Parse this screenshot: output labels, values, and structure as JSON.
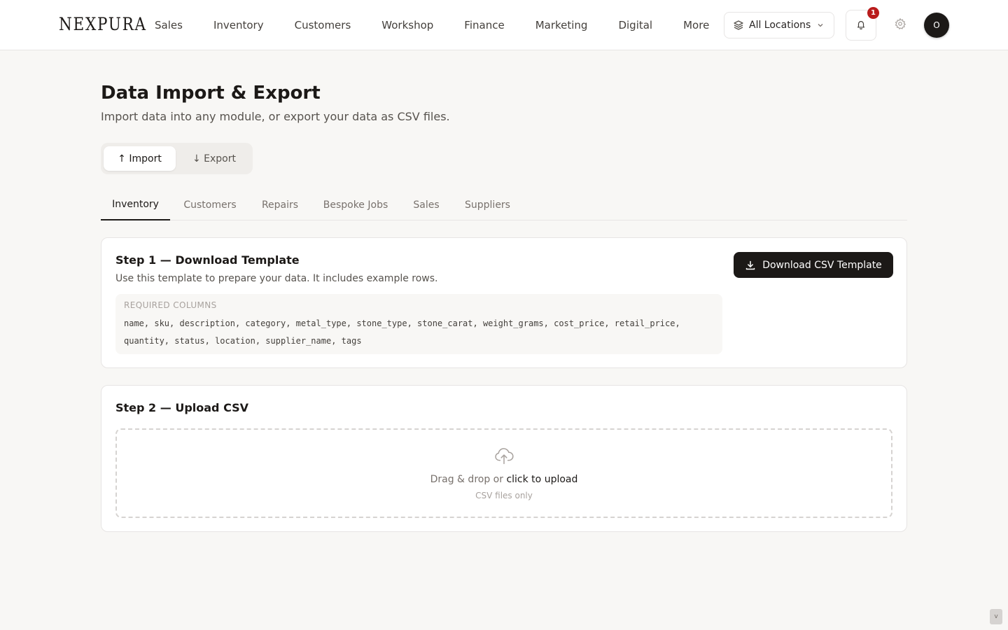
{
  "brand": "NEXPURA",
  "nav": [
    "Sales",
    "Inventory",
    "Customers",
    "Workshop",
    "Finance",
    "Marketing",
    "Digital",
    "More"
  ],
  "location_selector": {
    "label": "All Locations",
    "icon": "layers-icon"
  },
  "notifications": {
    "count": "1",
    "icon": "bell-icon"
  },
  "settings_icon": "gear-icon",
  "avatar_initial": "O",
  "page": {
    "title": "Data Import & Export",
    "subtitle": "Import data into any module, or export your data as CSV files."
  },
  "mode_toggle": {
    "import": "↑ Import",
    "export": "↓ Export",
    "selected": "import"
  },
  "module_tabs": [
    "Inventory",
    "Customers",
    "Repairs",
    "Bespoke Jobs",
    "Sales",
    "Suppliers"
  ],
  "active_tab": "Inventory",
  "step1": {
    "title": "Step 1 — Download Template",
    "description": "Use this template to prepare your data. It includes example rows.",
    "button": "Download CSV Template",
    "required_label": "REQUIRED COLUMNS",
    "columns_line1": "name, sku, description, category, metal_type, stone_type, stone_carat, weight_grams, cost_price, retail_price,",
    "columns_line2": "quantity, status, location, supplier_name, tags"
  },
  "step2": {
    "title": "Step 2 — Upload CSV",
    "drop_text": "Drag & drop or",
    "drop_link": "click to upload",
    "hint": "CSV files only"
  },
  "corner_badge": "v",
  "colors": {
    "primary": "#1c1917",
    "badge": "#b91c1c",
    "background": "#f8f7f5",
    "border": "#e7e5e4"
  }
}
